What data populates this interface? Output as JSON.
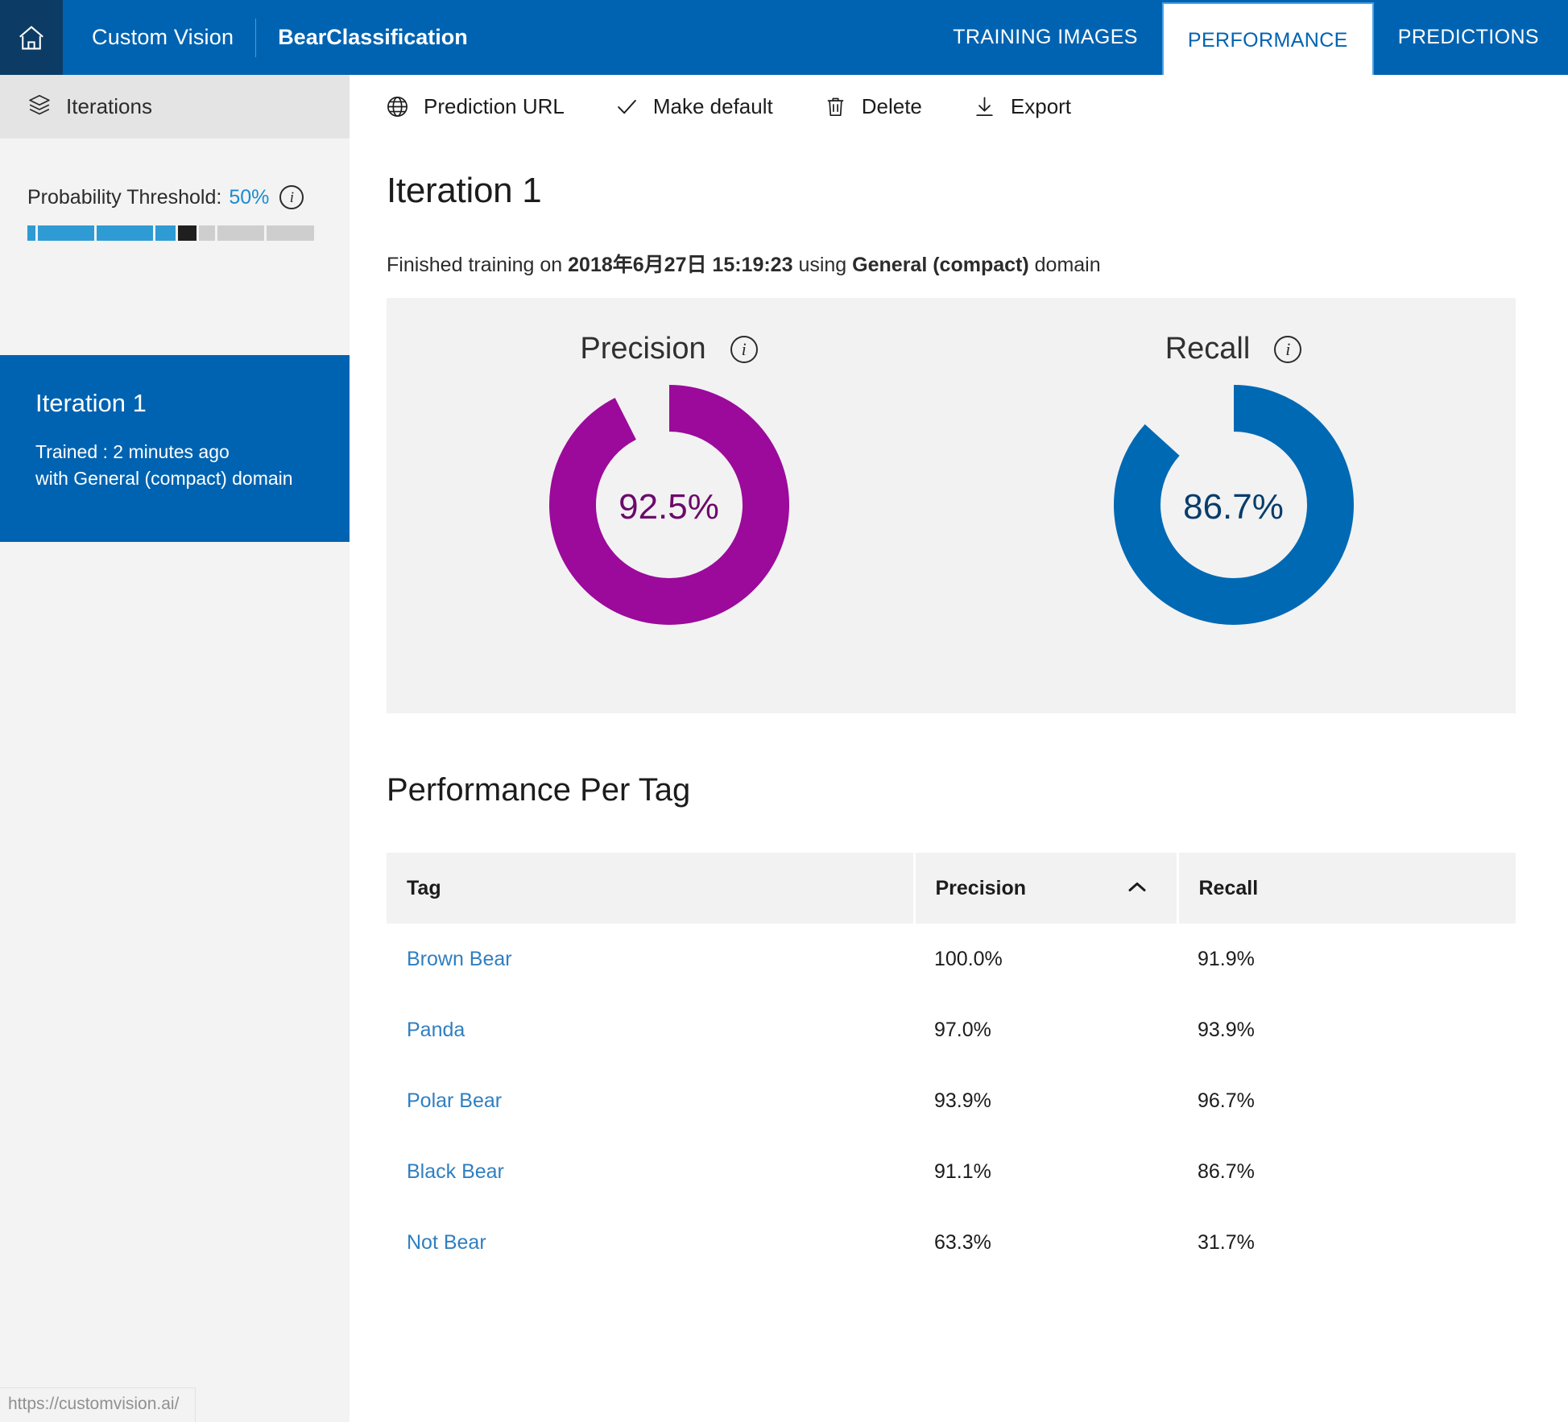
{
  "topbar": {
    "home_icon": "home-icon",
    "brand": "Custom Vision",
    "project": "BearClassification",
    "tabs": [
      {
        "label": "TRAINING IMAGES",
        "active": false
      },
      {
        "label": "PERFORMANCE",
        "active": true
      },
      {
        "label": "PREDICTIONS",
        "active": false
      }
    ]
  },
  "sidebar": {
    "header_label": "Iterations",
    "header_icon": "stack-icon",
    "threshold": {
      "label": "Probability Threshold:",
      "value": "50%",
      "info_icon": "info-icon",
      "percent": 50
    },
    "iteration_card": {
      "title": "Iteration 1",
      "trained_line": "Trained : 2 minutes ago",
      "domain_line": "with General (compact) domain"
    }
  },
  "status_bar": {
    "url": "https://customvision.ai/"
  },
  "toolbar": {
    "buttons": [
      {
        "label": "Prediction URL",
        "icon": "globe-icon"
      },
      {
        "label": "Make default",
        "icon": "check-icon"
      },
      {
        "label": "Delete",
        "icon": "trash-icon"
      },
      {
        "label": "Export",
        "icon": "download-icon"
      }
    ]
  },
  "main": {
    "page_title": "Iteration 1",
    "finished": {
      "prefix": "Finished training on ",
      "date": "2018年6月27日 15:19:23",
      "middle": " using ",
      "domain": "General (compact)",
      "suffix": " domain"
    },
    "section_title": "Performance Per Tag"
  },
  "chart_data": [
    {
      "type": "pie",
      "title": "Precision",
      "value": 92.5,
      "label": "92.5%",
      "color": "#9b0a9b",
      "track_color": "#f2f2f2",
      "info_icon": "info-icon"
    },
    {
      "type": "pie",
      "title": "Recall",
      "value": 86.7,
      "label": "86.7%",
      "color": "#0069b4",
      "track_color": "#f2f2f2",
      "info_icon": "info-icon"
    },
    {
      "type": "table",
      "title": "Performance Per Tag",
      "columns": [
        "Tag",
        "Precision",
        "Recall"
      ],
      "sort_column": "Precision",
      "sort_direction": "asc",
      "rows": [
        {
          "tag": "Brown Bear",
          "precision": "100.0%",
          "recall": "91.9%"
        },
        {
          "tag": "Panda",
          "precision": "97.0%",
          "recall": "93.9%"
        },
        {
          "tag": "Polar Bear",
          "precision": "93.9%",
          "recall": "96.7%"
        },
        {
          "tag": "Black Bear",
          "precision": "91.1%",
          "recall": "86.7%"
        },
        {
          "tag": "Not Bear",
          "precision": "63.3%",
          "recall": "31.7%"
        }
      ]
    }
  ],
  "colors": {
    "brand_blue": "#0063b1",
    "accent_link": "#2f7fc1",
    "precision_purple": "#9b0a9b",
    "recall_blue": "#0069b4",
    "slider_blue": "#2f9bd4"
  }
}
